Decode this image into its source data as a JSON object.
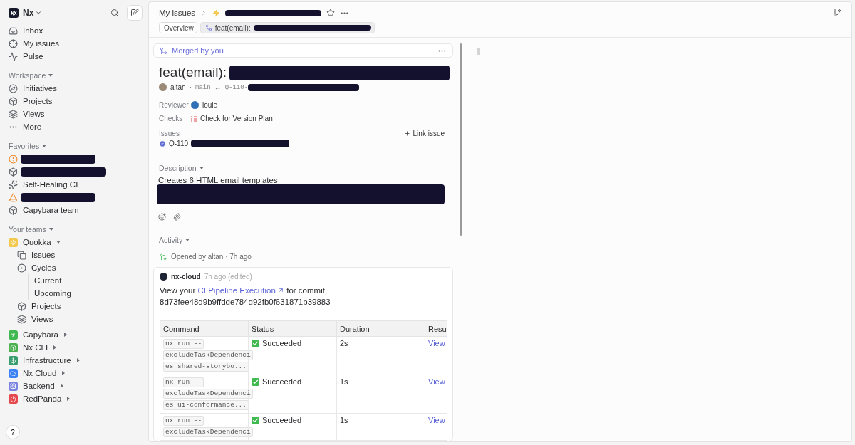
{
  "sidebar": {
    "workspace_name": "Nx",
    "nav": [
      {
        "label": "Inbox"
      },
      {
        "label": "My issues"
      },
      {
        "label": "Pulse"
      }
    ],
    "sections": [
      {
        "title": "Workspace",
        "expanded": true,
        "items": [
          {
            "kind": "link",
            "label": "Initiatives"
          },
          {
            "kind": "link",
            "label": "Projects"
          },
          {
            "kind": "link",
            "label": "Views"
          },
          {
            "kind": "link",
            "label": "More"
          }
        ]
      },
      {
        "title": "Favorites",
        "expanded": true,
        "items": [
          {
            "kind": "redacted"
          },
          {
            "kind": "redacted"
          },
          {
            "kind": "link",
            "label": "Self-Healing CI"
          },
          {
            "kind": "redacted"
          },
          {
            "kind": "link",
            "label": "Capybara team"
          }
        ]
      }
    ],
    "teams": {
      "title": "Your teams",
      "expanded": true,
      "items": [
        {
          "label": "Quokka",
          "color": "#f2c94c",
          "expanded": true,
          "children": [
            {
              "label": "Issues"
            },
            {
              "label": "Cycles",
              "children": [
                {
                  "label": "Current"
                },
                {
                  "label": "Upcoming"
                }
              ]
            },
            {
              "label": "Projects"
            },
            {
              "label": "Views"
            }
          ]
        },
        {
          "label": "Capybara",
          "color": "#3fb950",
          "expanded": false
        },
        {
          "label": "Nx CLI",
          "color": "#4caf50",
          "expanded": false
        },
        {
          "label": "Infrastructure",
          "color": "#3a9d6e",
          "expanded": false
        },
        {
          "label": "Nx Cloud",
          "color": "#3b82f6",
          "expanded": false
        },
        {
          "label": "Backend",
          "color": "#7c83e0",
          "expanded": false
        },
        {
          "label": "RedPanda",
          "color": "#e5484d",
          "expanded": false
        }
      ]
    },
    "help": "?"
  },
  "header": {
    "breadcrumb": "My issues",
    "tabs": [
      {
        "label": "Overview",
        "selected": false
      },
      {
        "label": "feat(email):",
        "selected": true
      }
    ]
  },
  "pr": {
    "status": "Merged by you",
    "title": "feat(email):",
    "author": "altan",
    "separator": "·",
    "base": "main",
    "arrow": "←",
    "branch": "Q-110-",
    "fields": [
      {
        "label": "Reviewer",
        "kind": "person",
        "value": "louie"
      },
      {
        "label": "Checks",
        "kind": "check",
        "value": "Check for Version Plan"
      }
    ],
    "issues_label": "Issues",
    "link_issue": "Link issue",
    "issue_id": "Q-110",
    "description_title": "Description",
    "description": "Creates 6 HTML email templates",
    "activity_title": "Activity",
    "opened": "Opened by altan · 7h ago",
    "comment": {
      "author": "nx-cloud",
      "time": "7h ago (edited)",
      "before": "View your",
      "link": "CI Pipeline Execution",
      "after": "for commit",
      "commit": "8d73fee48d9b9ffdde784d92fb0f631871b39883",
      "table": {
        "columns": [
          "Command",
          "Status",
          "Duration",
          "Resu"
        ],
        "rows": [
          {
            "command": [
              "nx run --",
              "excludeTaskDependenci",
              "es shared-storybo..."
            ],
            "status": {
              "kind": "success",
              "label": "Succeeded"
            },
            "duration": "2s",
            "result": "View"
          },
          {
            "command": [
              "nx run --",
              "excludeTaskDependenci",
              "es ui-conformance..."
            ],
            "status": {
              "kind": "success",
              "label": "Succeeded"
            },
            "duration": "1s",
            "result": "View"
          },
          {
            "command": [
              "nx run --",
              "excludeTaskDependenci"
            ],
            "status": {
              "kind": "success",
              "label": "Succeeded"
            },
            "duration": "1s",
            "result": "View"
          }
        ]
      }
    }
  }
}
